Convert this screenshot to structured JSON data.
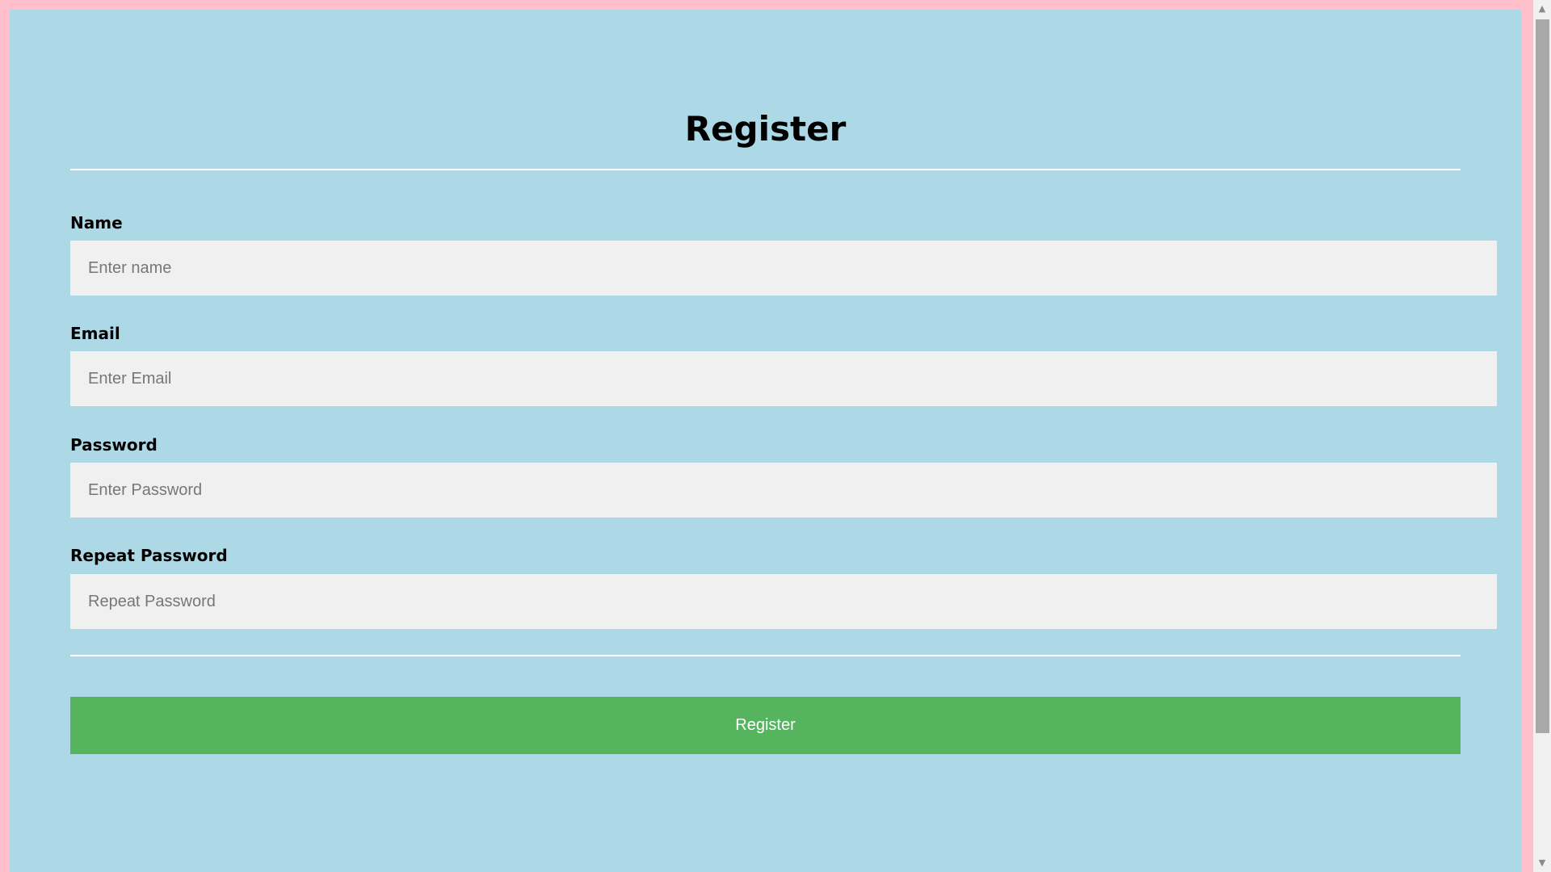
{
  "form": {
    "title": "Register",
    "fields": [
      {
        "label": "Name",
        "placeholder": "Enter name",
        "value": ""
      },
      {
        "label": "Email",
        "placeholder": "Enter Email",
        "value": ""
      },
      {
        "label": "Password",
        "placeholder": "Enter Password",
        "value": ""
      },
      {
        "label": "Repeat Password",
        "placeholder": "Repeat Password",
        "value": ""
      }
    ],
    "submit_label": "Register"
  },
  "scrollbar": {
    "up_icon": "chevron-up-icon",
    "down_icon": "chevron-down-icon"
  },
  "colors": {
    "page_background": "#ffc0cb",
    "form_background": "#add8e6",
    "input_background": "#eff0ef",
    "button_background": "#56b45f",
    "button_text": "#ffffff",
    "divider": "#ffffff"
  }
}
